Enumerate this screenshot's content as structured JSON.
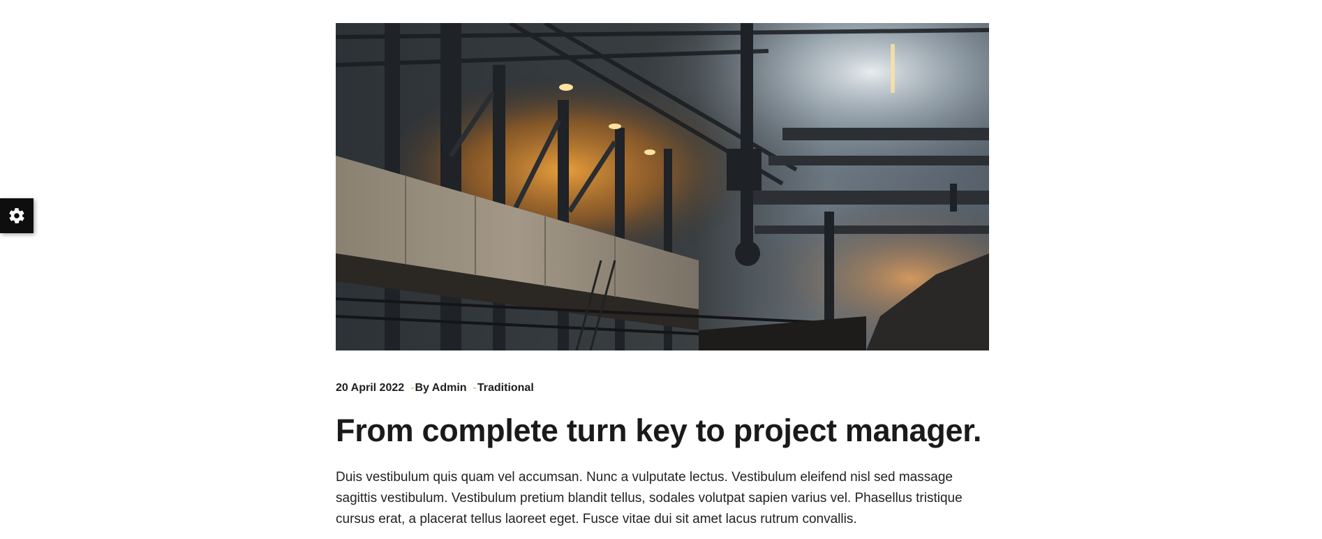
{
  "settings": {
    "icon": "gear-icon"
  },
  "post": {
    "image": {
      "subject": "industrial factory interior",
      "accent": "#e08a2c"
    },
    "meta": {
      "date": "20 April 2022",
      "separator": "-",
      "author": "By Admin",
      "category": "Traditional"
    },
    "title": "From complete turn key to project manager.",
    "excerpt": "Duis vestibulum quis quam vel accumsan. Nunc a vulputate lectus. Vestibulum eleifend nisl sed massage sagittis vestibulum. Vestibulum pretium blandit tellus, sodales volutpat sapien varius vel. Phasellus tristique cursus erat, a placerat tellus laoreet eget. Fusce vitae dui sit amet lacus rutrum convallis."
  }
}
